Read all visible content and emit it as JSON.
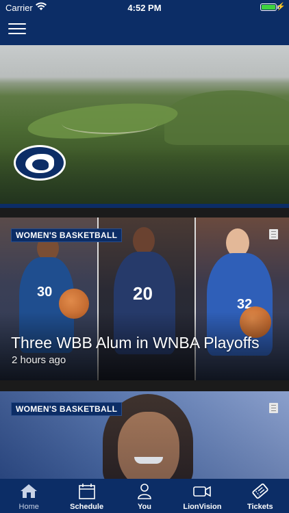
{
  "status_bar": {
    "carrier": "Carrier",
    "time": "4:52 PM",
    "wifi_icon": "wifi-icon",
    "battery_icon": "battery-icon"
  },
  "nav": {
    "menu_icon": "hamburger-menu-icon"
  },
  "hero": {
    "image": "golf-course-photo",
    "logo": "nittany-lion-logo"
  },
  "feed": [
    {
      "tag": "WOMEN'S BASKETBALL",
      "headline": "Three WBB Alum in WNBA Playoffs",
      "timestamp": "2 hours ago",
      "icon": "article-icon"
    },
    {
      "tag": "WOMEN'S BASKETBALL",
      "headline": "",
      "timestamp": "",
      "icon": "article-icon"
    }
  ],
  "tabs": [
    {
      "label": "Home",
      "icon": "home-icon",
      "active": true
    },
    {
      "label": "Schedule",
      "icon": "calendar-icon",
      "active": false
    },
    {
      "label": "You",
      "icon": "person-icon",
      "active": false
    },
    {
      "label": "LionVision",
      "icon": "video-camera-icon",
      "active": false
    },
    {
      "label": "Tickets",
      "icon": "ticket-icon",
      "active": false
    }
  ],
  "colors": {
    "brand_navy": "#0c2d66",
    "battery_green": "#3fd33f"
  }
}
